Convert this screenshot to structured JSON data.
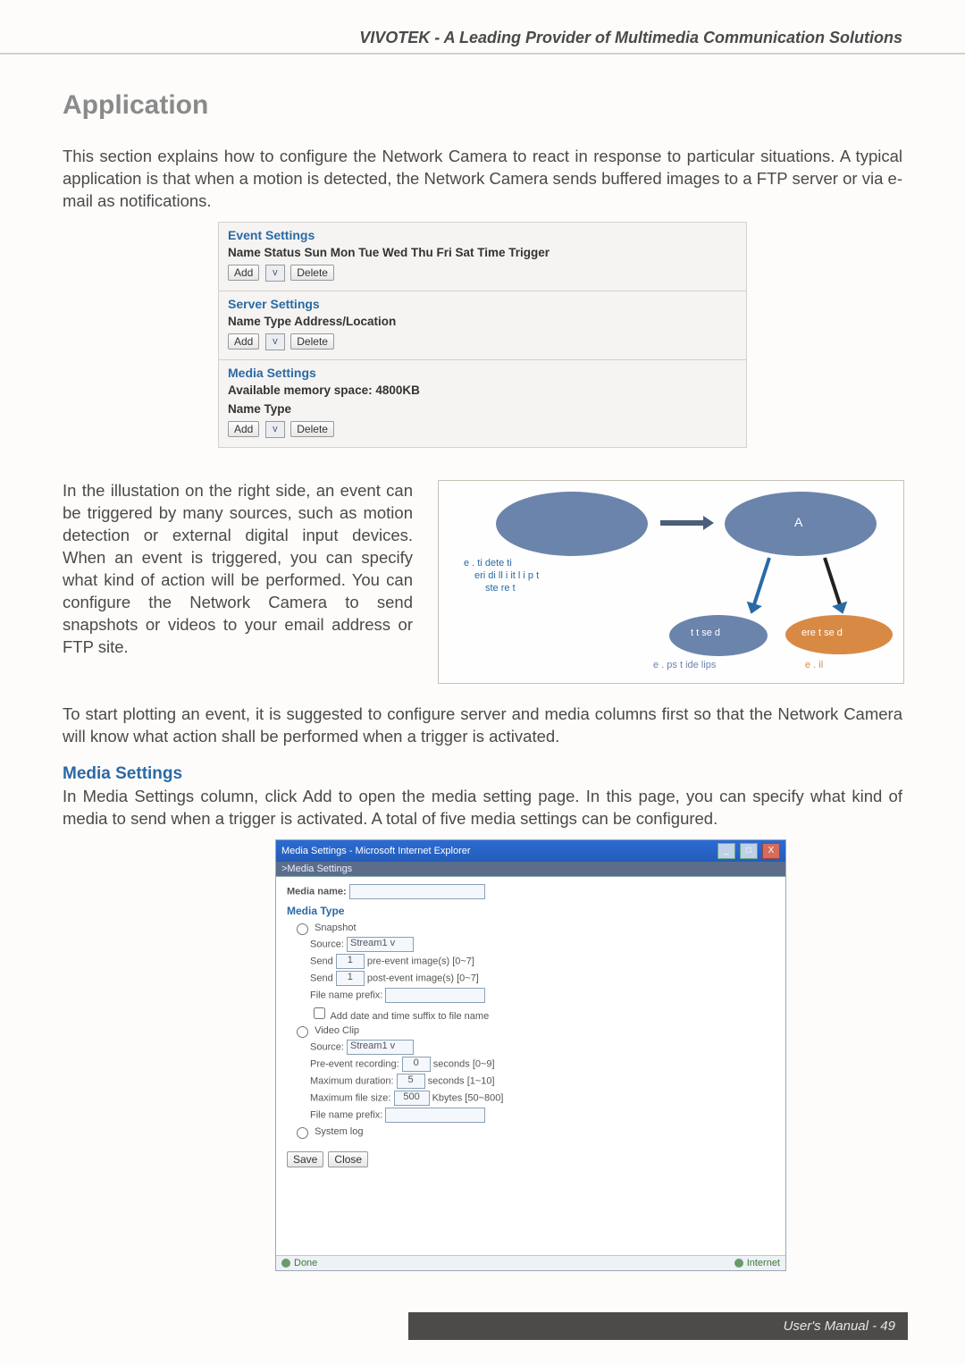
{
  "header": {
    "tagline": "VIVOTEK - A Leading Provider of Multimedia Communication Solutions"
  },
  "title": "Application",
  "intro": "This section explains how to configure the Network Camera to react in response to particular situations. A typical application is that when a motion is detected, the Network Camera sends buffered images to a FTP server or via e-mail as notifications.",
  "panel": {
    "event": {
      "legend": "Event Settings",
      "cols": "Name Status Sun Mon Tue Wed Thu Fri Sat Time Trigger",
      "add": "Add",
      "delete": "Delete"
    },
    "server": {
      "legend": "Server Settings",
      "cols": "Name Type Address/Location",
      "add": "Add",
      "delete": "Delete"
    },
    "media": {
      "legend": "Media Settings",
      "memory": "Available memory space: 4800KB",
      "cols": "Name Type",
      "add": "Add",
      "delete": "Delete"
    }
  },
  "para2": "In the illustation on the right side, an event can be triggered by many sources, such as motion detection or external digital input devices. When an event is triggered, you can specify what kind of action will be performed. You can configure the Network Camera to send snapshots or videos to your email address or FTP site.",
  "flow": {
    "bubble_a": "A",
    "label1a": "e .    ti    dete ti",
    "label1b": "eri di    ll     i it  l i p t",
    "label1c": "ste    re       t",
    "small1": "t t    se  d",
    "small2": "ere t    se  d",
    "sub1": "e .     ps  t    ide     lips",
    "sub2": "e .       il"
  },
  "para3": "To start plotting an event, it is suggested to configure server and media columns first so that the Network Camera will know what action shall be performed when a trigger is activated.",
  "media_section": {
    "heading": "Media Settings",
    "body": "In Media Settings column, click Add to open the media setting page. In this page, you can specify what kind of media to send when a trigger is activated. A total of five media settings can be configured."
  },
  "ie": {
    "title": "Media Settings - Microsoft Internet Explorer",
    "heading": ">Media Settings",
    "media_name_label": "Media name:",
    "media_type_legend": "Media Type",
    "snapshot": "Snapshot",
    "source": "Source:",
    "stream1": "Stream1",
    "send1_pre": "Send",
    "send1_val": "1",
    "send1_post": "pre-event image(s) [0~7]",
    "send2_pre": "Send",
    "send2_val": "1",
    "send2_post": "post-event image(s) [0~7]",
    "file_prefix": "File name prefix:",
    "add_date": "Add date and time suffix to file name",
    "video_clip": "Video Clip",
    "pre_rec_label": "Pre-event recording:",
    "pre_rec_val": "0",
    "pre_rec_post": "seconds [0~9]",
    "max_dur_label": "Maximum duration:",
    "max_dur_val": "5",
    "max_dur_post": "seconds [1~10]",
    "max_size_label": "Maximum file size:",
    "max_size_val": "500",
    "max_size_post": "Kbytes [50~800]",
    "system_log": "System log",
    "save": "Save",
    "close": "Close",
    "status_done": "Done",
    "status_zone": "Internet"
  },
  "footer": {
    "page": "User's Manual - 49"
  }
}
